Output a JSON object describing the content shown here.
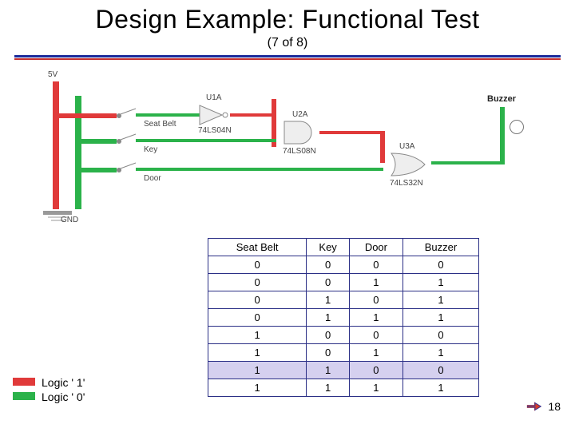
{
  "title": "Design Example: Functional Test",
  "subtitle": "(7 of 8)",
  "circuit": {
    "power_label": "5V",
    "gnd_label": "GND",
    "inputs": [
      "Seat Belt",
      "Key",
      "Door"
    ],
    "gates": [
      {
        "ref": "U1A",
        "part": "74LS04N"
      },
      {
        "ref": "U2A",
        "part": "74LS08N"
      },
      {
        "ref": "U3A",
        "part": "74LS32N"
      }
    ],
    "output_label": "Buzzer"
  },
  "chart_data": {
    "type": "table",
    "title": "Truth table",
    "columns": [
      "Seat Belt",
      "Key",
      "Door",
      "Buzzer"
    ],
    "rows": [
      [
        0,
        0,
        0,
        0
      ],
      [
        0,
        0,
        1,
        1
      ],
      [
        0,
        1,
        0,
        1
      ],
      [
        0,
        1,
        1,
        1
      ],
      [
        1,
        0,
        0,
        0
      ],
      [
        1,
        0,
        1,
        1
      ],
      [
        1,
        1,
        0,
        0
      ],
      [
        1,
        1,
        1,
        1
      ]
    ],
    "highlighted_row_index": 6
  },
  "legend": {
    "high": "Logic ' 1'",
    "low": "Logic ' 0'"
  },
  "page_number": "18",
  "colors": {
    "logic1": "#e03a3a",
    "logic0": "#2bb24a",
    "rule_primary": "#1b2a9b",
    "rule_secondary": "#c22e2e",
    "table_border": "#2b2f86",
    "highlight_bg": "#d5d0ef"
  }
}
